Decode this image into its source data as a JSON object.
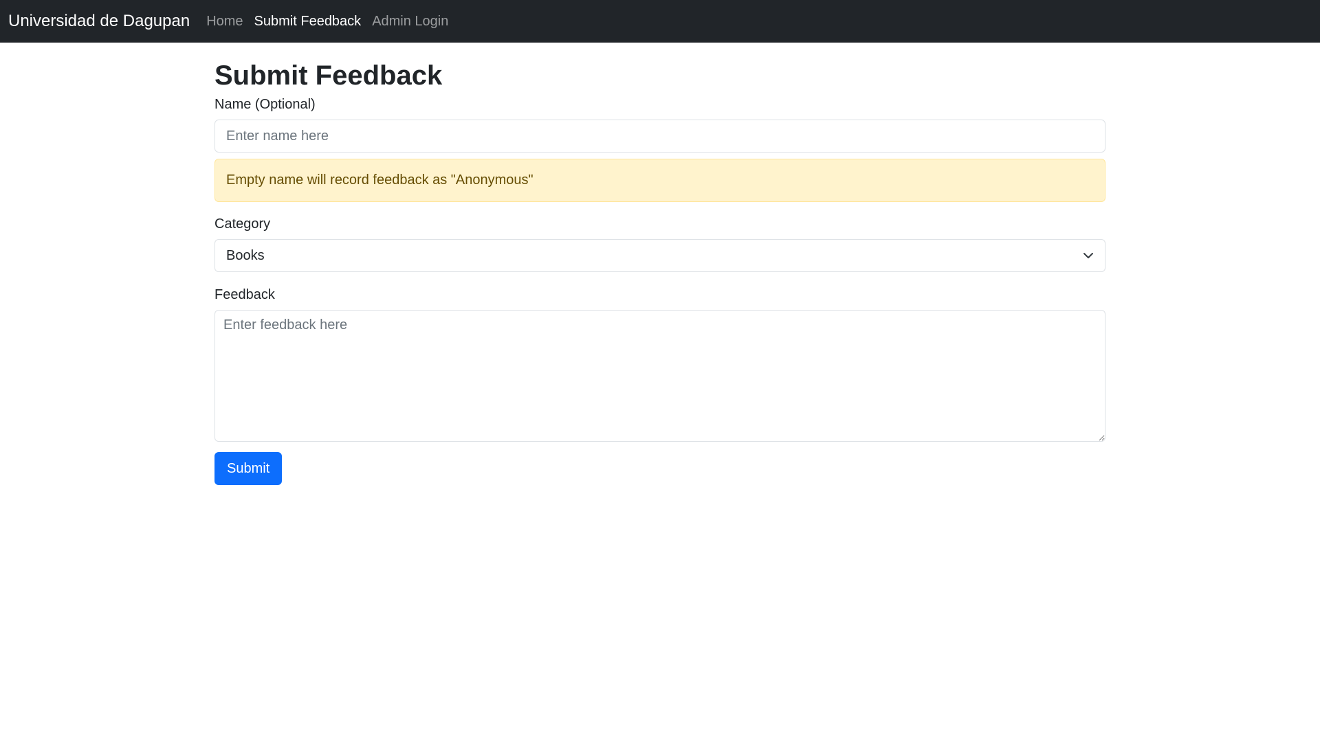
{
  "navbar": {
    "brand": "Universidad de Dagupan",
    "links": [
      {
        "label": "Home",
        "active": false
      },
      {
        "label": "Submit Feedback",
        "active": true
      },
      {
        "label": "Admin Login",
        "active": false
      }
    ]
  },
  "page": {
    "title": "Submit Feedback"
  },
  "form": {
    "name": {
      "label": "Name (Optional)",
      "placeholder": "Enter name here",
      "value": ""
    },
    "alert": {
      "text": "Empty name will record feedback as \"Anonymous\""
    },
    "category": {
      "label": "Category",
      "selected": "Books",
      "icon": "chevron-down-icon"
    },
    "feedback": {
      "label": "Feedback",
      "placeholder": "Enter feedback here",
      "value": ""
    },
    "submit_label": "Submit"
  },
  "colors": {
    "navbar_bg": "#212529",
    "primary": "#0d6efd",
    "alert_bg": "#fff3cd",
    "alert_text": "#664d03"
  }
}
